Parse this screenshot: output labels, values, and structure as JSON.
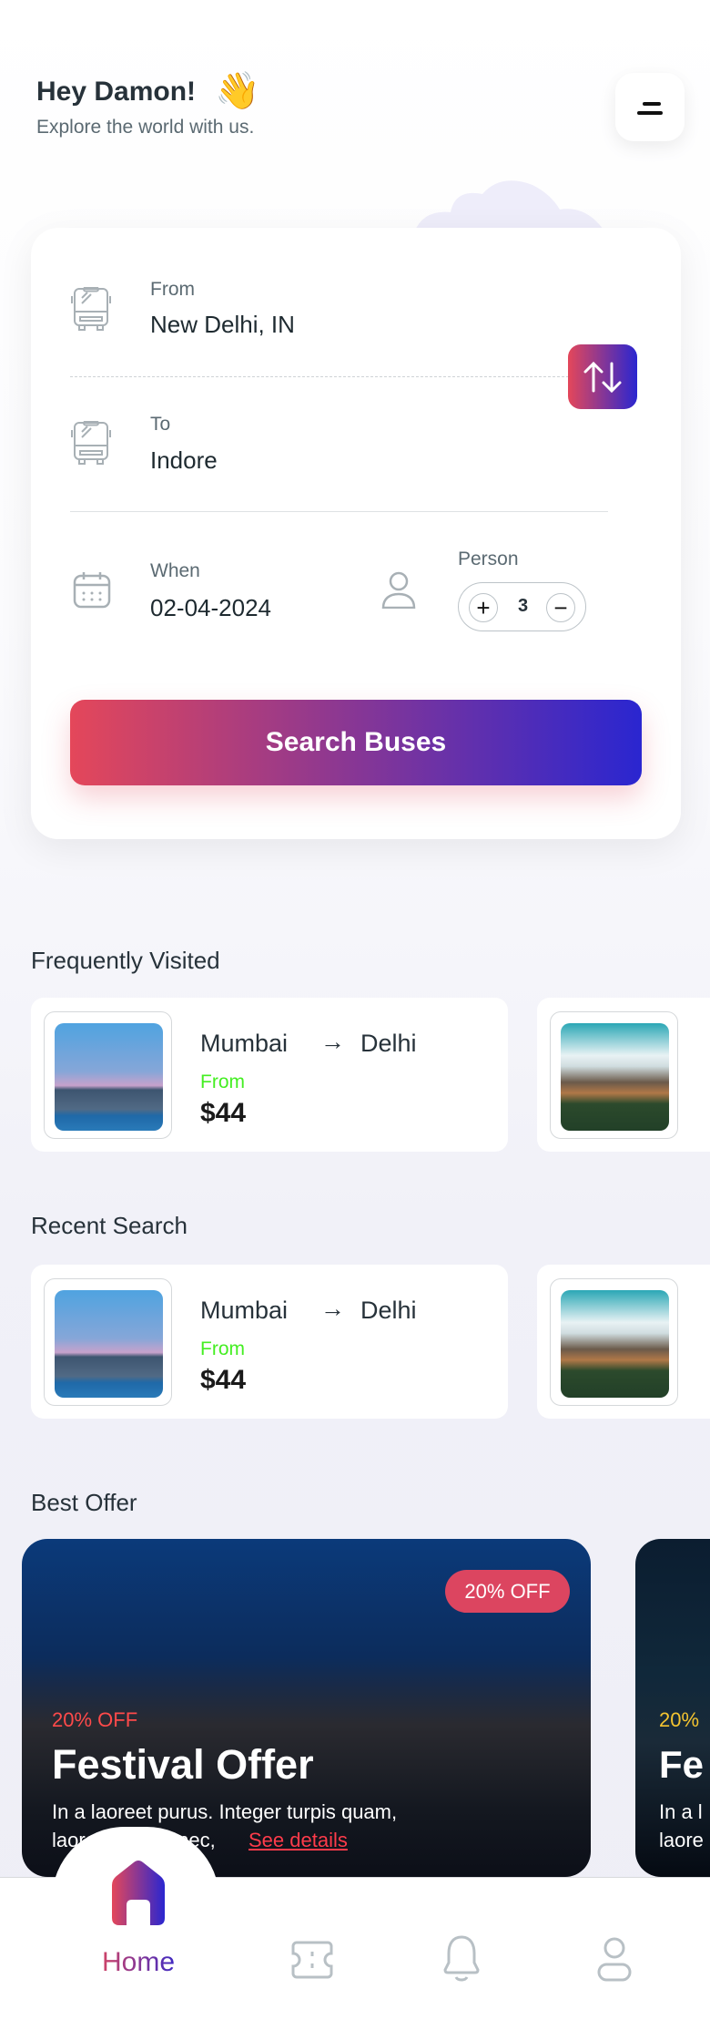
{
  "header": {
    "greeting": "Hey Damon!",
    "wave_emoji": "👋",
    "subtitle": "Explore the world with us.",
    "menu_icon": "menu-icon"
  },
  "search_form": {
    "from_label": "From",
    "from_value": "New Delhi, IN",
    "to_label": "To",
    "to_value": "Indore",
    "when_label": "When",
    "when_value": "02-04-2024",
    "person_label": "Person",
    "person_count": "3",
    "plus": "+",
    "minus": "−",
    "search_button": "Search Buses"
  },
  "frequently_visited": {
    "title": "Frequently Visited",
    "items": [
      {
        "origin": "Mumbai",
        "destination": "Delhi",
        "from_label": "From",
        "price": "$44"
      },
      {
        "origin": "",
        "destination": "",
        "from_label": "",
        "price": ""
      }
    ]
  },
  "recent_search": {
    "title": "Recent Search",
    "items": [
      {
        "origin": "Mumbai",
        "destination": "Delhi",
        "from_label": "From",
        "price": "$44"
      },
      {
        "origin": "",
        "destination": "",
        "from_label": "",
        "price": ""
      }
    ]
  },
  "best_offer": {
    "title": "Best Offer",
    "items": [
      {
        "badge": "20% OFF",
        "discount": "20% OFF",
        "title": "Festival Offer",
        "description_1": "In a laoreet purus. Integer turpis quam,",
        "description_2": "laoreet id orci nec,",
        "link": "See details"
      },
      {
        "discount": "20%",
        "title": "Fe",
        "description_1": "In a l",
        "description_2": "laore"
      }
    ]
  },
  "bottom_nav": {
    "items": [
      {
        "label": "Home",
        "icon": "home-icon",
        "active": true
      },
      {
        "icon": "ticket-icon"
      },
      {
        "icon": "bell-icon"
      },
      {
        "icon": "user-icon"
      }
    ]
  },
  "colors": {
    "gradient_start": "#e4475a",
    "gradient_end": "#2a26d0",
    "from_green": "#44ee22",
    "badge": "#dc4560",
    "text": "#27323a"
  }
}
